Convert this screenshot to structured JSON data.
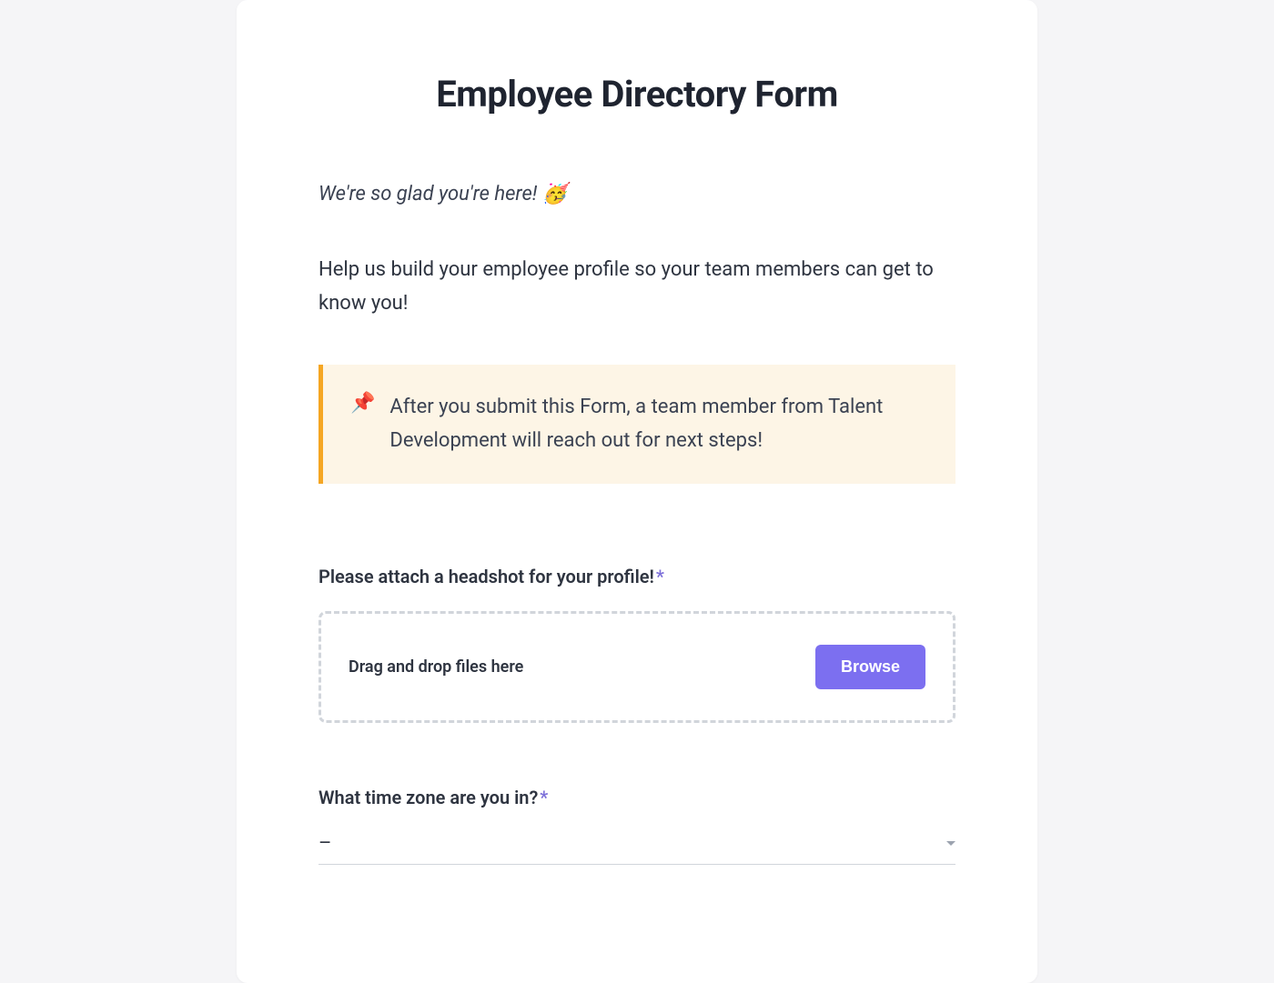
{
  "form": {
    "title": "Employee Directory Form",
    "intro_italic": "We're so glad you're here! 🥳",
    "intro_text": "Help us build your employee profile so your team members can get to know you!",
    "callout": {
      "icon": "📌",
      "text": "After you submit this Form, a team member from Talent Development will reach out for next steps!"
    },
    "fields": {
      "headshot": {
        "label": "Please attach a headshot for your profile!",
        "required_marker": "*",
        "dropzone_text": "Drag and drop files here",
        "browse_label": "Browse"
      },
      "timezone": {
        "label": "What time zone are you in?",
        "required_marker": "*",
        "selected_value": "–"
      }
    }
  }
}
